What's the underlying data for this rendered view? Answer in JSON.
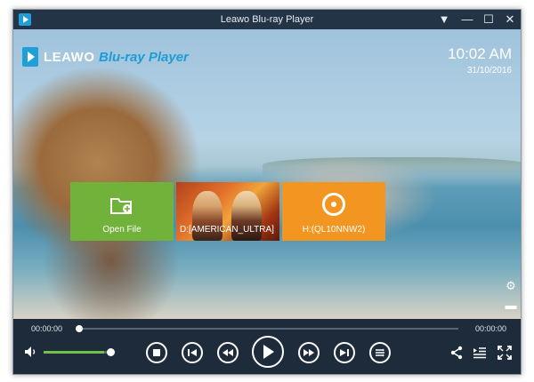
{
  "window": {
    "title": "Leawo Blu-ray Player",
    "controls": {
      "menu": "▼",
      "minimize": "—",
      "maximize": "☐",
      "close": "✕"
    }
  },
  "logo": {
    "brand": "LEAWO",
    "product": "Blu-ray Player"
  },
  "clock": {
    "time": "10:02 AM",
    "date": "31/10/2016"
  },
  "tiles": [
    {
      "label": "Open File",
      "icon": "folder-add-icon",
      "color": "#71b23a"
    },
    {
      "label": "D:[AMERICAN_ULTRA]",
      "icon": "movie-poster",
      "color": "#e2702a"
    },
    {
      "label": "H:(QL10NNW2)",
      "icon": "disc-icon",
      "color": "#f39521"
    }
  ],
  "side_icons": {
    "settings": "⚙",
    "subtitle": "▬"
  },
  "playback": {
    "elapsed": "00:00:00",
    "total": "00:00:00",
    "progress": 0
  },
  "volume": {
    "level": 0.9,
    "accent": "#72c24a"
  },
  "control_buttons": [
    "stop",
    "previous",
    "rewind",
    "play",
    "fast-forward",
    "next",
    "playlist-mode"
  ],
  "right_controls": [
    "share",
    "playlist",
    "fullscreen"
  ]
}
